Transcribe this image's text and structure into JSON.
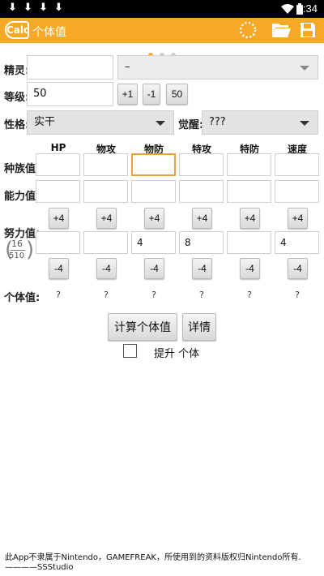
{
  "status_bar": {
    "time": "9:34",
    "download_icons": [
      "⬇",
      "⬇",
      "⬇",
      "⬇"
    ]
  },
  "app_bar": {
    "logo_text": "Calc",
    "title": "个体值",
    "icons": [
      "loading-ring-icon",
      "folder-open-icon",
      "save-disk-icon"
    ],
    "accent": "#f6a827"
  },
  "pager": {
    "count": 3,
    "active": 1
  },
  "form": {
    "pokemon_label": "精灵:",
    "pokemon_value": "",
    "pokemon_select": "–",
    "level_label": "等级:",
    "level_value": "50",
    "level_buttons": [
      "+1",
      "-1",
      "50"
    ],
    "nature_label": "性格:",
    "nature_value": "实干",
    "ability_label": "觉醒:",
    "ability_value": "???"
  },
  "stats": {
    "columns": [
      "HP",
      "物攻",
      "物防",
      "特攻",
      "特防",
      "速度"
    ],
    "base_label": "种族值:",
    "base_values": [
      "",
      "",
      "",
      "",
      "",
      ""
    ],
    "stat_label": "能力值:",
    "stat_values": [
      "",
      "",
      "",
      "",
      "",
      ""
    ],
    "ev_label": "努力值:",
    "ev_values": [
      "",
      "",
      "4",
      "8",
      "",
      "4"
    ],
    "ev_plus": [
      "+4",
      "+4",
      "+4",
      "+4",
      "+4",
      "+4"
    ],
    "ev_minus": [
      "-4",
      "-4",
      "-4",
      "-4",
      "-4",
      "-4"
    ],
    "ev_used": "16",
    "ev_total": "510",
    "iv_label": "个体值:",
    "iv_values": [
      "?",
      "?",
      "?",
      "?",
      "?",
      "?"
    ]
  },
  "actions": {
    "calculate": "计算个体值",
    "details": "详情",
    "boost_label": "提升 个体",
    "boost_checked": false
  },
  "footer": "此App不隶属于Nintendo，GAMEFREAK，所使用到的资料版权归Nintendo所有.————SSStudio"
}
